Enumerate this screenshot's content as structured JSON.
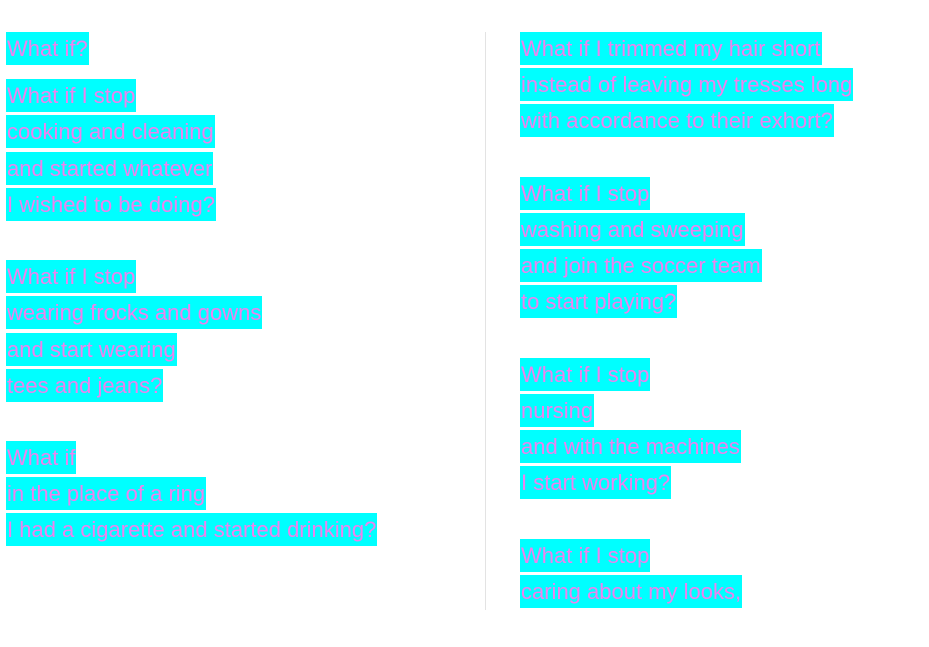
{
  "colors": {
    "text": "#ee82ee",
    "highlight": "#00ffff"
  },
  "left": {
    "title": "What if?",
    "stanzas": [
      [
        "What if I stop",
        "cooking and cleaning",
        "and started whatever",
        "I wished to be doing?"
      ],
      [
        "What if I stop",
        "wearing frocks and gowns",
        "and start wearing",
        "tees and jeans?"
      ],
      [
        "What if",
        "in the place of a ring",
        "I had a cigarette and started drinking?"
      ]
    ]
  },
  "right": {
    "stanzas": [
      [
        "What if I trimmed my hair short",
        "instead of leaving my tresses long",
        "with accordance to their exhort?"
      ],
      [
        "What if I stop",
        "washing and sweeping",
        "and join the soccer team",
        "to start playing?"
      ],
      [
        "What if I stop",
        "nursing",
        "and with the machines",
        "I start working?"
      ],
      [
        "What if I stop",
        "caring about my looks,"
      ]
    ]
  }
}
